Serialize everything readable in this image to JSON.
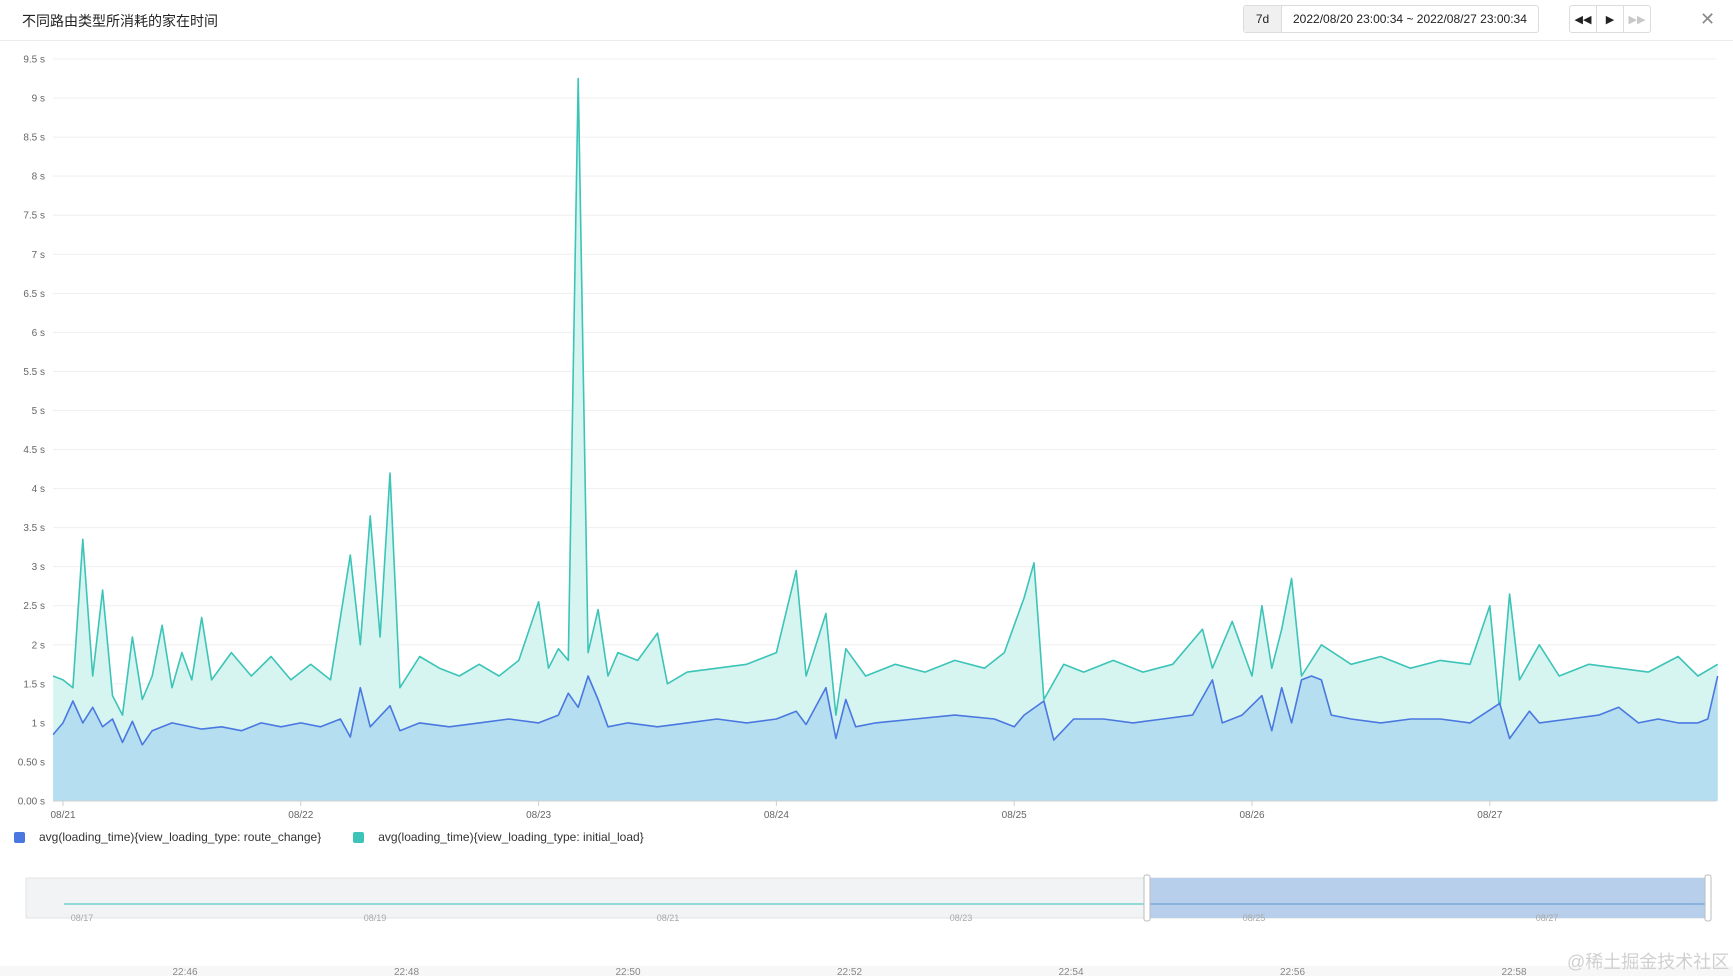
{
  "header": {
    "title": "不同路由类型所消耗的家在时间",
    "range_button": "7d",
    "range_text": "2022/08/20 23:00:34 ~ 2022/08/27 23:00:34"
  },
  "icons": {
    "rewind": "rewind-icon",
    "play": "play-icon",
    "fast_forward": "fast-forward-icon",
    "close": "close-icon"
  },
  "colors": {
    "route_change": "#4a78e0",
    "initial_load": "#3cc4b8",
    "route_change_fill": "#b5dff0",
    "initial_load_fill": "#d6f4f0"
  },
  "watermark": "@稀土掘金技术社区",
  "chart_data": {
    "type": "area",
    "title": "不同路由类型所消耗的家在时间",
    "yticks": [
      "0.00 s",
      "0.50 s",
      "1 s",
      "1.5 s",
      "2 s",
      "2.5 s",
      "3 s",
      "3.5 s",
      "4 s",
      "4.5 s",
      "5 s",
      "5.5 s",
      "6 s",
      "6.5 s",
      "7 s",
      "7.5 s",
      "8 s",
      "8.5 s",
      "9 s",
      "9.5 s"
    ],
    "ylim": [
      0,
      9.5
    ],
    "xticks": [
      "08/21",
      "08/22",
      "08/23",
      "08/24",
      "08/25",
      "08/26",
      "08/27"
    ],
    "xlim": [
      "2022-08-20T23:00",
      "2022-08-27T23:00"
    ],
    "grid": true,
    "legend_position": "bottom-left",
    "series": [
      {
        "name": "avg(loading_time){view_loading_type: route_change}",
        "points": [
          [
            "2022-08-20T23:00",
            0.85
          ],
          [
            "2022-08-21T00:00",
            1.0
          ],
          [
            "2022-08-21T01:00",
            1.28
          ],
          [
            "2022-08-21T02:00",
            1.0
          ],
          [
            "2022-08-21T03:00",
            1.2
          ],
          [
            "2022-08-21T04:00",
            0.95
          ],
          [
            "2022-08-21T05:00",
            1.05
          ],
          [
            "2022-08-21T06:00",
            0.75
          ],
          [
            "2022-08-21T07:00",
            1.02
          ],
          [
            "2022-08-21T08:00",
            0.72
          ],
          [
            "2022-08-21T09:00",
            0.9
          ],
          [
            "2022-08-21T11:00",
            1.0
          ],
          [
            "2022-08-21T14:00",
            0.92
          ],
          [
            "2022-08-21T16:00",
            0.95
          ],
          [
            "2022-08-21T18:00",
            0.9
          ],
          [
            "2022-08-21T20:00",
            1.0
          ],
          [
            "2022-08-21T22:00",
            0.95
          ],
          [
            "2022-08-22T00:00",
            1.0
          ],
          [
            "2022-08-22T02:00",
            0.95
          ],
          [
            "2022-08-22T04:00",
            1.05
          ],
          [
            "2022-08-22T05:00",
            0.82
          ],
          [
            "2022-08-22T06:00",
            1.45
          ],
          [
            "2022-08-22T07:00",
            0.95
          ],
          [
            "2022-08-22T09:00",
            1.22
          ],
          [
            "2022-08-22T10:00",
            0.9
          ],
          [
            "2022-08-22T12:00",
            1.0
          ],
          [
            "2022-08-22T15:00",
            0.95
          ],
          [
            "2022-08-22T18:00",
            1.0
          ],
          [
            "2022-08-22T21:00",
            1.05
          ],
          [
            "2022-08-23T00:00",
            1.0
          ],
          [
            "2022-08-23T02:00",
            1.1
          ],
          [
            "2022-08-23T03:00",
            1.38
          ],
          [
            "2022-08-23T04:00",
            1.2
          ],
          [
            "2022-08-23T05:00",
            1.6
          ],
          [
            "2022-08-23T06:00",
            1.3
          ],
          [
            "2022-08-23T07:00",
            0.95
          ],
          [
            "2022-08-23T09:00",
            1.0
          ],
          [
            "2022-08-23T12:00",
            0.95
          ],
          [
            "2022-08-23T15:00",
            1.0
          ],
          [
            "2022-08-23T18:00",
            1.05
          ],
          [
            "2022-08-23T21:00",
            1.0
          ],
          [
            "2022-08-24T00:00",
            1.05
          ],
          [
            "2022-08-24T02:00",
            1.15
          ],
          [
            "2022-08-24T03:00",
            0.98
          ],
          [
            "2022-08-24T05:00",
            1.45
          ],
          [
            "2022-08-24T06:00",
            0.8
          ],
          [
            "2022-08-24T07:00",
            1.3
          ],
          [
            "2022-08-24T08:00",
            0.95
          ],
          [
            "2022-08-24T10:00",
            1.0
          ],
          [
            "2022-08-24T14:00",
            1.05
          ],
          [
            "2022-08-24T18:00",
            1.1
          ],
          [
            "2022-08-24T22:00",
            1.05
          ],
          [
            "2022-08-25T00:00",
            0.95
          ],
          [
            "2022-08-25T01:00",
            1.1
          ],
          [
            "2022-08-25T03:00",
            1.28
          ],
          [
            "2022-08-25T04:00",
            0.78
          ],
          [
            "2022-08-25T06:00",
            1.05
          ],
          [
            "2022-08-25T09:00",
            1.05
          ],
          [
            "2022-08-25T12:00",
            1.0
          ],
          [
            "2022-08-25T15:00",
            1.05
          ],
          [
            "2022-08-25T18:00",
            1.1
          ],
          [
            "2022-08-25T20:00",
            1.55
          ],
          [
            "2022-08-25T21:00",
            1.0
          ],
          [
            "2022-08-25T23:00",
            1.1
          ],
          [
            "2022-08-26T01:00",
            1.35
          ],
          [
            "2022-08-26T02:00",
            0.9
          ],
          [
            "2022-08-26T03:00",
            1.45
          ],
          [
            "2022-08-26T04:00",
            1.0
          ],
          [
            "2022-08-26T05:00",
            1.55
          ],
          [
            "2022-08-26T06:00",
            1.6
          ],
          [
            "2022-08-26T07:00",
            1.55
          ],
          [
            "2022-08-26T08:00",
            1.1
          ],
          [
            "2022-08-26T10:00",
            1.05
          ],
          [
            "2022-08-26T13:00",
            1.0
          ],
          [
            "2022-08-26T16:00",
            1.05
          ],
          [
            "2022-08-26T19:00",
            1.05
          ],
          [
            "2022-08-26T22:00",
            1.0
          ],
          [
            "2022-08-27T01:00",
            1.25
          ],
          [
            "2022-08-27T02:00",
            0.8
          ],
          [
            "2022-08-27T04:00",
            1.15
          ],
          [
            "2022-08-27T05:00",
            1.0
          ],
          [
            "2022-08-27T08:00",
            1.05
          ],
          [
            "2022-08-27T11:00",
            1.1
          ],
          [
            "2022-08-27T13:00",
            1.2
          ],
          [
            "2022-08-27T15:00",
            1.0
          ],
          [
            "2022-08-27T17:00",
            1.05
          ],
          [
            "2022-08-27T19:00",
            1.0
          ],
          [
            "2022-08-27T21:00",
            1.0
          ],
          [
            "2022-08-27T22:00",
            1.05
          ],
          [
            "2022-08-27T23:00",
            1.6
          ]
        ]
      },
      {
        "name": "avg(loading_time){view_loading_type: initial_load}",
        "points": [
          [
            "2022-08-20T23:00",
            1.6
          ],
          [
            "2022-08-21T00:00",
            1.55
          ],
          [
            "2022-08-21T01:00",
            1.45
          ],
          [
            "2022-08-21T02:00",
            3.35
          ],
          [
            "2022-08-21T03:00",
            1.6
          ],
          [
            "2022-08-21T04:00",
            2.7
          ],
          [
            "2022-08-21T05:00",
            1.35
          ],
          [
            "2022-08-21T06:00",
            1.1
          ],
          [
            "2022-08-21T07:00",
            2.1
          ],
          [
            "2022-08-21T08:00",
            1.3
          ],
          [
            "2022-08-21T09:00",
            1.6
          ],
          [
            "2022-08-21T10:00",
            2.25
          ],
          [
            "2022-08-21T11:00",
            1.45
          ],
          [
            "2022-08-21T12:00",
            1.9
          ],
          [
            "2022-08-21T13:00",
            1.55
          ],
          [
            "2022-08-21T14:00",
            2.35
          ],
          [
            "2022-08-21T15:00",
            1.55
          ],
          [
            "2022-08-21T17:00",
            1.9
          ],
          [
            "2022-08-21T19:00",
            1.6
          ],
          [
            "2022-08-21T21:00",
            1.85
          ],
          [
            "2022-08-21T23:00",
            1.55
          ],
          [
            "2022-08-22T01:00",
            1.75
          ],
          [
            "2022-08-22T03:00",
            1.55
          ],
          [
            "2022-08-22T05:00",
            3.15
          ],
          [
            "2022-08-22T06:00",
            2.0
          ],
          [
            "2022-08-22T07:00",
            3.65
          ],
          [
            "2022-08-22T08:00",
            2.1
          ],
          [
            "2022-08-22T09:00",
            4.2
          ],
          [
            "2022-08-22T10:00",
            1.45
          ],
          [
            "2022-08-22T12:00",
            1.85
          ],
          [
            "2022-08-22T14:00",
            1.7
          ],
          [
            "2022-08-22T16:00",
            1.6
          ],
          [
            "2022-08-22T18:00",
            1.75
          ],
          [
            "2022-08-22T20:00",
            1.6
          ],
          [
            "2022-08-22T22:00",
            1.8
          ],
          [
            "2022-08-23T00:00",
            2.55
          ],
          [
            "2022-08-23T01:00",
            1.7
          ],
          [
            "2022-08-23T02:00",
            1.95
          ],
          [
            "2022-08-23T03:00",
            1.8
          ],
          [
            "2022-08-23T04:00",
            9.25
          ],
          [
            "2022-08-23T05:00",
            1.9
          ],
          [
            "2022-08-23T06:00",
            2.45
          ],
          [
            "2022-08-23T07:00",
            1.6
          ],
          [
            "2022-08-23T08:00",
            1.9
          ],
          [
            "2022-08-23T10:00",
            1.8
          ],
          [
            "2022-08-23T12:00",
            2.15
          ],
          [
            "2022-08-23T13:00",
            1.5
          ],
          [
            "2022-08-23T15:00",
            1.65
          ],
          [
            "2022-08-23T18:00",
            1.7
          ],
          [
            "2022-08-23T21:00",
            1.75
          ],
          [
            "2022-08-24T00:00",
            1.9
          ],
          [
            "2022-08-24T02:00",
            2.95
          ],
          [
            "2022-08-24T03:00",
            1.6
          ],
          [
            "2022-08-24T05:00",
            2.4
          ],
          [
            "2022-08-24T06:00",
            1.1
          ],
          [
            "2022-08-24T07:00",
            1.95
          ],
          [
            "2022-08-24T09:00",
            1.6
          ],
          [
            "2022-08-24T12:00",
            1.75
          ],
          [
            "2022-08-24T15:00",
            1.65
          ],
          [
            "2022-08-24T18:00",
            1.8
          ],
          [
            "2022-08-24T21:00",
            1.7
          ],
          [
            "2022-08-24T23:00",
            1.9
          ],
          [
            "2022-08-25T01:00",
            2.6
          ],
          [
            "2022-08-25T02:00",
            3.05
          ],
          [
            "2022-08-25T03:00",
            1.3
          ],
          [
            "2022-08-25T05:00",
            1.75
          ],
          [
            "2022-08-25T07:00",
            1.65
          ],
          [
            "2022-08-25T10:00",
            1.8
          ],
          [
            "2022-08-25T13:00",
            1.65
          ],
          [
            "2022-08-25T16:00",
            1.75
          ],
          [
            "2022-08-25T19:00",
            2.2
          ],
          [
            "2022-08-25T20:00",
            1.7
          ],
          [
            "2022-08-25T22:00",
            2.3
          ],
          [
            "2022-08-26T00:00",
            1.6
          ],
          [
            "2022-08-26T01:00",
            2.5
          ],
          [
            "2022-08-26T02:00",
            1.7
          ],
          [
            "2022-08-26T03:00",
            2.2
          ],
          [
            "2022-08-26T04:00",
            2.85
          ],
          [
            "2022-08-26T05:00",
            1.6
          ],
          [
            "2022-08-26T07:00",
            2.0
          ],
          [
            "2022-08-26T10:00",
            1.75
          ],
          [
            "2022-08-26T13:00",
            1.85
          ],
          [
            "2022-08-26T16:00",
            1.7
          ],
          [
            "2022-08-26T19:00",
            1.8
          ],
          [
            "2022-08-26T22:00",
            1.75
          ],
          [
            "2022-08-27T00:00",
            2.5
          ],
          [
            "2022-08-27T01:00",
            1.15
          ],
          [
            "2022-08-27T02:00",
            2.65
          ],
          [
            "2022-08-27T03:00",
            1.55
          ],
          [
            "2022-08-27T05:00",
            2.0
          ],
          [
            "2022-08-27T07:00",
            1.6
          ],
          [
            "2022-08-27T10:00",
            1.75
          ],
          [
            "2022-08-27T13:00",
            1.7
          ],
          [
            "2022-08-27T16:00",
            1.65
          ],
          [
            "2022-08-27T19:00",
            1.85
          ],
          [
            "2022-08-27T21:00",
            1.6
          ],
          [
            "2022-08-27T23:00",
            1.75
          ]
        ]
      }
    ],
    "overview": {
      "xticks": [
        "08/17",
        "08/19",
        "08/21",
        "08/23",
        "08/25",
        "08/27"
      ],
      "selected_range": [
        "2022-08-20T23:00",
        "2022-08-27T23:00"
      ]
    },
    "background_xticks": [
      "22:46",
      "22:48",
      "22:50",
      "22:52",
      "22:54",
      "22:56",
      "22:58"
    ]
  }
}
